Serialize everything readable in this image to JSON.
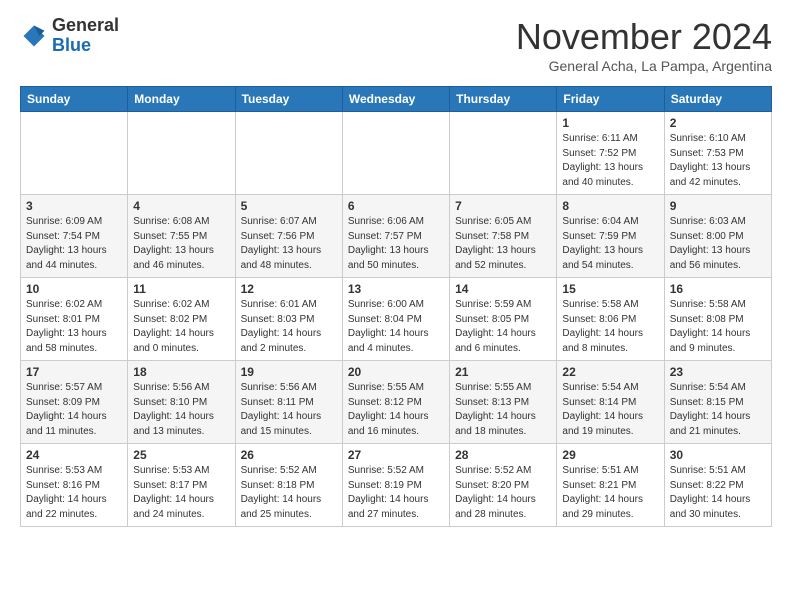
{
  "header": {
    "logo_general": "General",
    "logo_blue": "Blue",
    "month_title": "November 2024",
    "location": "General Acha, La Pampa, Argentina"
  },
  "days_of_week": [
    "Sunday",
    "Monday",
    "Tuesday",
    "Wednesday",
    "Thursday",
    "Friday",
    "Saturday"
  ],
  "weeks": [
    [
      {
        "day": "",
        "info": ""
      },
      {
        "day": "",
        "info": ""
      },
      {
        "day": "",
        "info": ""
      },
      {
        "day": "",
        "info": ""
      },
      {
        "day": "",
        "info": ""
      },
      {
        "day": "1",
        "info": "Sunrise: 6:11 AM\nSunset: 7:52 PM\nDaylight: 13 hours\nand 40 minutes."
      },
      {
        "day": "2",
        "info": "Sunrise: 6:10 AM\nSunset: 7:53 PM\nDaylight: 13 hours\nand 42 minutes."
      }
    ],
    [
      {
        "day": "3",
        "info": "Sunrise: 6:09 AM\nSunset: 7:54 PM\nDaylight: 13 hours\nand 44 minutes."
      },
      {
        "day": "4",
        "info": "Sunrise: 6:08 AM\nSunset: 7:55 PM\nDaylight: 13 hours\nand 46 minutes."
      },
      {
        "day": "5",
        "info": "Sunrise: 6:07 AM\nSunset: 7:56 PM\nDaylight: 13 hours\nand 48 minutes."
      },
      {
        "day": "6",
        "info": "Sunrise: 6:06 AM\nSunset: 7:57 PM\nDaylight: 13 hours\nand 50 minutes."
      },
      {
        "day": "7",
        "info": "Sunrise: 6:05 AM\nSunset: 7:58 PM\nDaylight: 13 hours\nand 52 minutes."
      },
      {
        "day": "8",
        "info": "Sunrise: 6:04 AM\nSunset: 7:59 PM\nDaylight: 13 hours\nand 54 minutes."
      },
      {
        "day": "9",
        "info": "Sunrise: 6:03 AM\nSunset: 8:00 PM\nDaylight: 13 hours\nand 56 minutes."
      }
    ],
    [
      {
        "day": "10",
        "info": "Sunrise: 6:02 AM\nSunset: 8:01 PM\nDaylight: 13 hours\nand 58 minutes."
      },
      {
        "day": "11",
        "info": "Sunrise: 6:02 AM\nSunset: 8:02 PM\nDaylight: 14 hours\nand 0 minutes."
      },
      {
        "day": "12",
        "info": "Sunrise: 6:01 AM\nSunset: 8:03 PM\nDaylight: 14 hours\nand 2 minutes."
      },
      {
        "day": "13",
        "info": "Sunrise: 6:00 AM\nSunset: 8:04 PM\nDaylight: 14 hours\nand 4 minutes."
      },
      {
        "day": "14",
        "info": "Sunrise: 5:59 AM\nSunset: 8:05 PM\nDaylight: 14 hours\nand 6 minutes."
      },
      {
        "day": "15",
        "info": "Sunrise: 5:58 AM\nSunset: 8:06 PM\nDaylight: 14 hours\nand 8 minutes."
      },
      {
        "day": "16",
        "info": "Sunrise: 5:58 AM\nSunset: 8:08 PM\nDaylight: 14 hours\nand 9 minutes."
      }
    ],
    [
      {
        "day": "17",
        "info": "Sunrise: 5:57 AM\nSunset: 8:09 PM\nDaylight: 14 hours\nand 11 minutes."
      },
      {
        "day": "18",
        "info": "Sunrise: 5:56 AM\nSunset: 8:10 PM\nDaylight: 14 hours\nand 13 minutes."
      },
      {
        "day": "19",
        "info": "Sunrise: 5:56 AM\nSunset: 8:11 PM\nDaylight: 14 hours\nand 15 minutes."
      },
      {
        "day": "20",
        "info": "Sunrise: 5:55 AM\nSunset: 8:12 PM\nDaylight: 14 hours\nand 16 minutes."
      },
      {
        "day": "21",
        "info": "Sunrise: 5:55 AM\nSunset: 8:13 PM\nDaylight: 14 hours\nand 18 minutes."
      },
      {
        "day": "22",
        "info": "Sunrise: 5:54 AM\nSunset: 8:14 PM\nDaylight: 14 hours\nand 19 minutes."
      },
      {
        "day": "23",
        "info": "Sunrise: 5:54 AM\nSunset: 8:15 PM\nDaylight: 14 hours\nand 21 minutes."
      }
    ],
    [
      {
        "day": "24",
        "info": "Sunrise: 5:53 AM\nSunset: 8:16 PM\nDaylight: 14 hours\nand 22 minutes."
      },
      {
        "day": "25",
        "info": "Sunrise: 5:53 AM\nSunset: 8:17 PM\nDaylight: 14 hours\nand 24 minutes."
      },
      {
        "day": "26",
        "info": "Sunrise: 5:52 AM\nSunset: 8:18 PM\nDaylight: 14 hours\nand 25 minutes."
      },
      {
        "day": "27",
        "info": "Sunrise: 5:52 AM\nSunset: 8:19 PM\nDaylight: 14 hours\nand 27 minutes."
      },
      {
        "day": "28",
        "info": "Sunrise: 5:52 AM\nSunset: 8:20 PM\nDaylight: 14 hours\nand 28 minutes."
      },
      {
        "day": "29",
        "info": "Sunrise: 5:51 AM\nSunset: 8:21 PM\nDaylight: 14 hours\nand 29 minutes."
      },
      {
        "day": "30",
        "info": "Sunrise: 5:51 AM\nSunset: 8:22 PM\nDaylight: 14 hours\nand 30 minutes."
      }
    ]
  ]
}
